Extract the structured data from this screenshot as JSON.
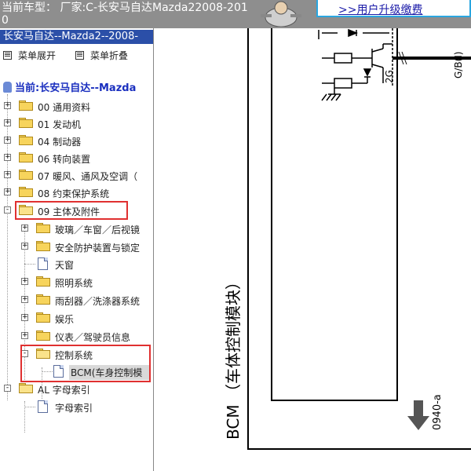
{
  "header": {
    "vehicle_info": "当前车型： 厂家:C-长安马自达Mazda22008-2010",
    "upgrade_link": ">>用户升级缴费"
  },
  "sidebar": {
    "title": "长安马自达--Mazda2--2008-",
    "expand_all": "菜单展开",
    "collapse_all": "菜单折叠",
    "current_node": "当前:长安马自达--Mazda",
    "items": [
      {
        "label": "00 通用资料",
        "expander": "+"
      },
      {
        "label": "01 发动机",
        "expander": "+"
      },
      {
        "label": "04 制动器",
        "expander": "+"
      },
      {
        "label": "06 转向装置",
        "expander": "+"
      },
      {
        "label": "07 暖风、通风及空调（",
        "expander": "+"
      },
      {
        "label": "08 约束保护系统",
        "expander": "+"
      },
      {
        "label": "09 主体及附件",
        "expander": "-"
      },
      {
        "label": "玻璃／车窗／后视镜",
        "expander": "+"
      },
      {
        "label": "安全防护装置与锁定",
        "expander": "+"
      },
      {
        "label": "天窗",
        "expander": ""
      },
      {
        "label": "照明系统",
        "expander": "+"
      },
      {
        "label": "雨刮器／洗涤器系统",
        "expander": "+"
      },
      {
        "label": "娱乐",
        "expander": "+"
      },
      {
        "label": "仪表／驾驶员信息",
        "expander": "+"
      },
      {
        "label": "控制系统",
        "expander": "-"
      },
      {
        "label": "BCM(车身控制模",
        "expander": ""
      },
      {
        "label": "AL 字母索引",
        "expander": "-"
      },
      {
        "label": "字母索引",
        "expander": ""
      }
    ]
  },
  "diagram": {
    "module_label": "BCM （车体控制模块）",
    "connector_label": "2G",
    "wire_label": "G/B(I)",
    "page_ref": "0940-a"
  },
  "colors": {
    "header_bg": "#8e8e8e",
    "title_bar": "#2b4fa8",
    "highlight": "#e03030",
    "link": "#1a1aa8"
  }
}
